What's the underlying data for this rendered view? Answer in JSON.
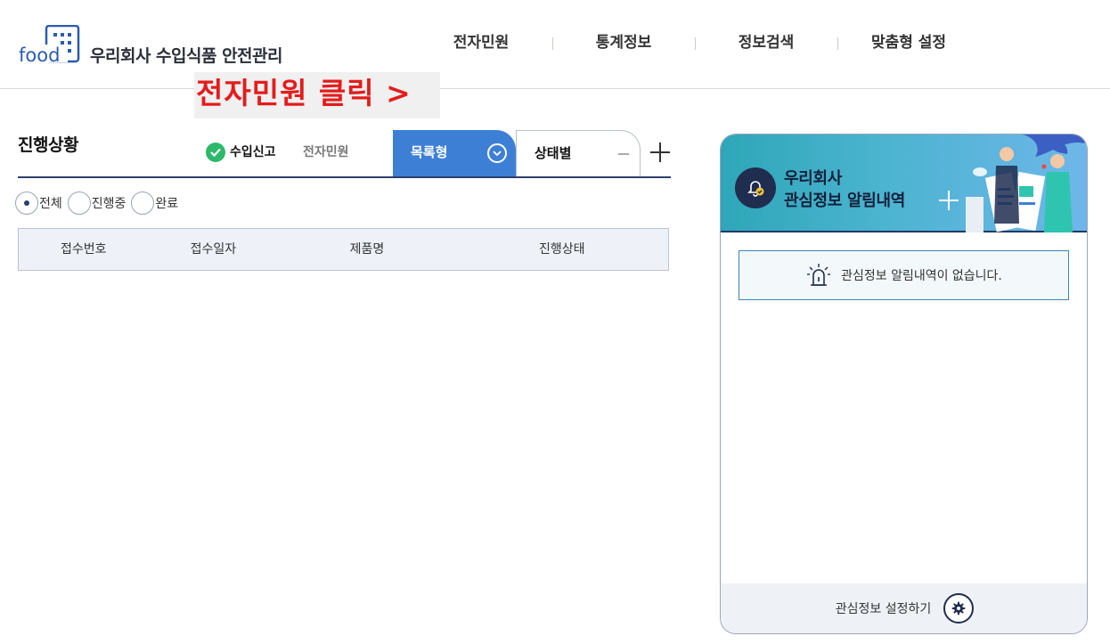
{
  "header": {
    "logo_text": "food",
    "site_title": "우리회사 수입식품 안전관리",
    "nav": [
      "전자민원",
      "통계정보",
      "정보검색",
      "맞춤형 설정"
    ]
  },
  "annotation": "전자민원 클릭 >",
  "progress": {
    "title": "진행상황",
    "type_tabs": {
      "active": "수입신고",
      "inactive": "전자민원"
    },
    "view_tabs": {
      "list": "목록형",
      "status": "상태별"
    },
    "filters": [
      "전체",
      "진행중",
      "완료"
    ],
    "selected_filter": "전체",
    "columns": [
      "접수번호",
      "접수일자",
      "제품명",
      "진행상태"
    ]
  },
  "alerts": {
    "title_line1": "우리회사",
    "title_line2": "관심정보 알림내역",
    "empty_message": "관심정보 알림내역이 없습니다.",
    "settings_label": "관심정보 설정하기"
  },
  "colors": {
    "primary": "#3e7fd6",
    "navy": "#1f2d4f",
    "annotation_red": "#e41c1c",
    "check_green": "#2fb86a"
  }
}
